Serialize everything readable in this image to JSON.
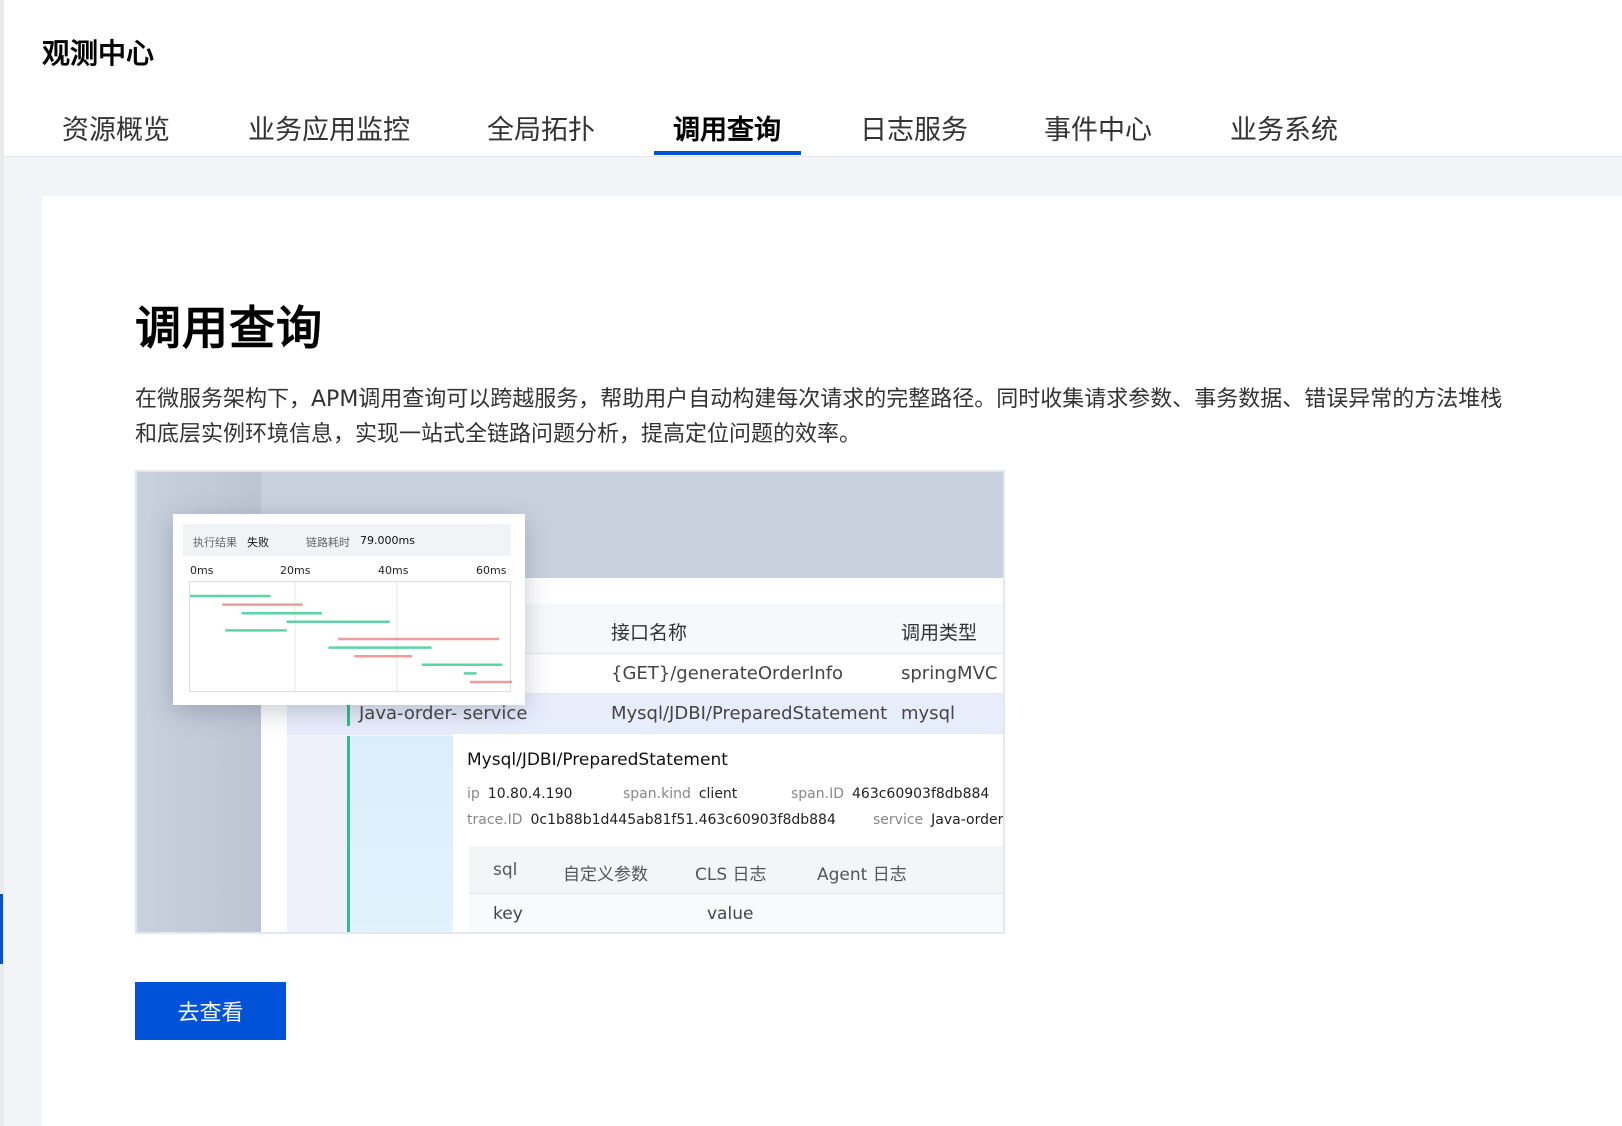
{
  "app": {
    "title": "观测中心"
  },
  "tabs": [
    {
      "label": "资源概览"
    },
    {
      "label": "业务应用监控"
    },
    {
      "label": "全局拓扑"
    },
    {
      "label": "调用查询"
    },
    {
      "label": "日志服务"
    },
    {
      "label": "事件中心"
    },
    {
      "label": "业务系统"
    }
  ],
  "active_tab": "调用查询",
  "main": {
    "title": "调用查询",
    "description": "在微服务架构下，APM调用查询可以跨越服务，帮助用户自动构建每次请求的完整路径。同时收集请求参数、事务数据、错误异常的方法堆栈和底层实例环境信息，实现一站式全链路问题分析，提高定位问题的效率。",
    "button_label": "去查看"
  },
  "illustration": {
    "popup": {
      "result_key": "执行结果",
      "result_value": "失败",
      "duration_key": "链路耗时",
      "duration_value": "79.000ms",
      "axis_labels": [
        "0ms",
        "20ms",
        "40ms",
        "60ms"
      ],
      "bars": [
        {
          "start": 0.0,
          "end": 0.25,
          "color": "#5dd4a3"
        },
        {
          "start": 0.1,
          "end": 0.35,
          "color": "#f19a9a"
        },
        {
          "start": 0.16,
          "end": 0.41,
          "color": "#5dd4a3"
        },
        {
          "start": 0.3,
          "end": 0.62,
          "color": "#5dd4a3"
        },
        {
          "start": 0.11,
          "end": 0.3,
          "color": "#5dd4a3"
        },
        {
          "start": 0.46,
          "end": 0.96,
          "color": "#f19a9a"
        },
        {
          "start": 0.43,
          "end": 0.75,
          "color": "#5dd4a3"
        },
        {
          "start": 0.51,
          "end": 0.69,
          "color": "#f19a9a"
        },
        {
          "start": 0.72,
          "end": 0.97,
          "color": "#5dd4a3"
        },
        {
          "start": 0.85,
          "end": 0.89,
          "color": "#5dd4a3"
        },
        {
          "start": 0.87,
          "end": 1.0,
          "color": "#f19a9a"
        }
      ]
    },
    "table": {
      "col_interface": "接口名称",
      "col_type": "调用类型",
      "row1_interface": "{GET}/generateOrderInfo",
      "row1_type": "springMVC",
      "row2_service": "Java-order- service",
      "row2_interface": "Mysql/JDBI/PreparedStatement",
      "row2_type": "mysql"
    },
    "detail": {
      "title": "Mysql/JDBI/PreparedStatement",
      "ip_key": "ip",
      "ip_value": "10.80.4.190",
      "kind_key": "span.kind",
      "kind_value": "client",
      "span_key": "span.ID",
      "span_value": "463c60903f8db884",
      "trace_key": "trace.ID",
      "trace_value": "0c1b88b1d445ab81f51.463c60903f8db884",
      "service_key": "service",
      "service_value": "Java-order",
      "tabs": [
        "sql",
        "自定义参数",
        "CLS 日志",
        "Agent 日志"
      ],
      "kv_key": "key",
      "kv_value": "value"
    }
  }
}
